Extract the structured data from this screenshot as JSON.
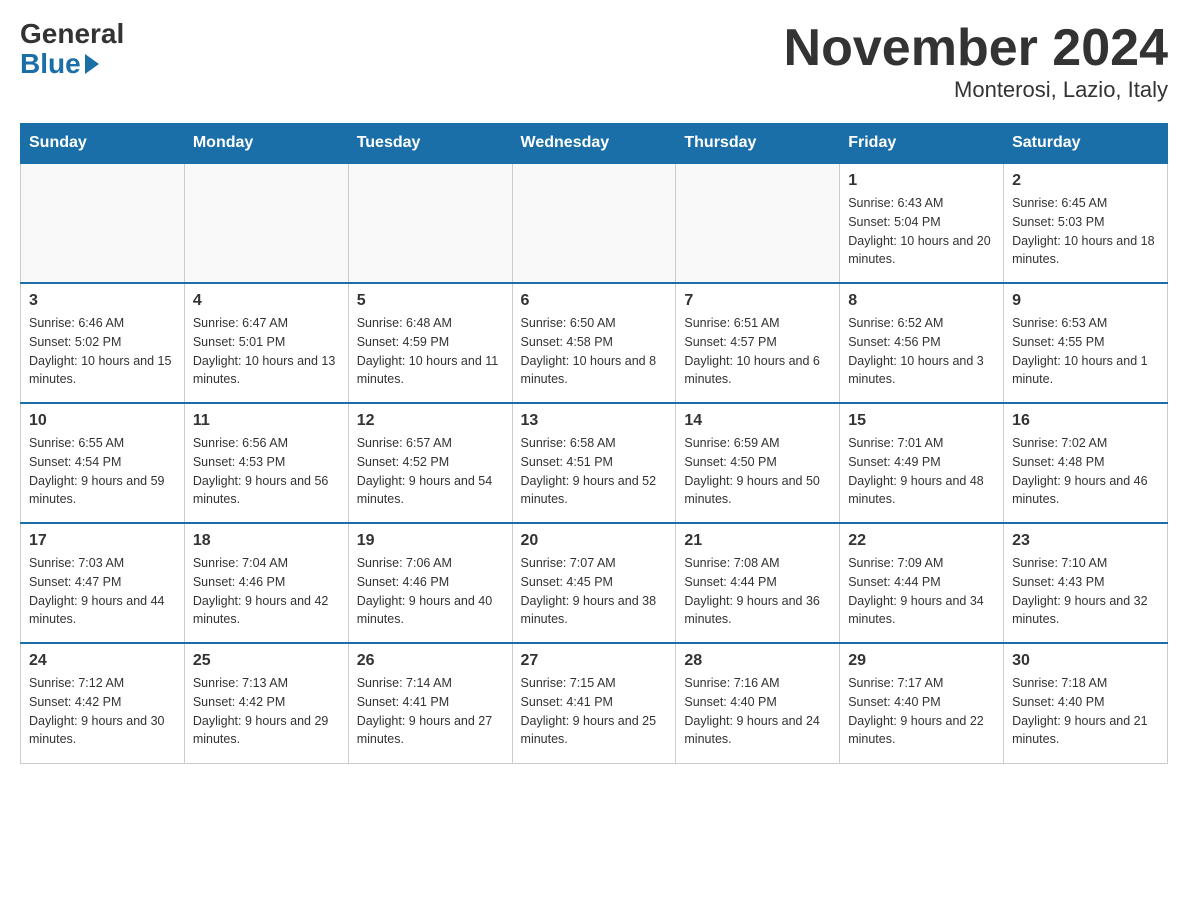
{
  "header": {
    "logo_general": "General",
    "logo_blue": "Blue",
    "title": "November 2024",
    "subtitle": "Monterosi, Lazio, Italy"
  },
  "days_of_week": [
    "Sunday",
    "Monday",
    "Tuesday",
    "Wednesday",
    "Thursday",
    "Friday",
    "Saturday"
  ],
  "weeks": [
    [
      {
        "day": "",
        "sunrise": "",
        "sunset": "",
        "daylight": ""
      },
      {
        "day": "",
        "sunrise": "",
        "sunset": "",
        "daylight": ""
      },
      {
        "day": "",
        "sunrise": "",
        "sunset": "",
        "daylight": ""
      },
      {
        "day": "",
        "sunrise": "",
        "sunset": "",
        "daylight": ""
      },
      {
        "day": "",
        "sunrise": "",
        "sunset": "",
        "daylight": ""
      },
      {
        "day": "1",
        "sunrise": "Sunrise: 6:43 AM",
        "sunset": "Sunset: 5:04 PM",
        "daylight": "Daylight: 10 hours and 20 minutes."
      },
      {
        "day": "2",
        "sunrise": "Sunrise: 6:45 AM",
        "sunset": "Sunset: 5:03 PM",
        "daylight": "Daylight: 10 hours and 18 minutes."
      }
    ],
    [
      {
        "day": "3",
        "sunrise": "Sunrise: 6:46 AM",
        "sunset": "Sunset: 5:02 PM",
        "daylight": "Daylight: 10 hours and 15 minutes."
      },
      {
        "day": "4",
        "sunrise": "Sunrise: 6:47 AM",
        "sunset": "Sunset: 5:01 PM",
        "daylight": "Daylight: 10 hours and 13 minutes."
      },
      {
        "day": "5",
        "sunrise": "Sunrise: 6:48 AM",
        "sunset": "Sunset: 4:59 PM",
        "daylight": "Daylight: 10 hours and 11 minutes."
      },
      {
        "day": "6",
        "sunrise": "Sunrise: 6:50 AM",
        "sunset": "Sunset: 4:58 PM",
        "daylight": "Daylight: 10 hours and 8 minutes."
      },
      {
        "day": "7",
        "sunrise": "Sunrise: 6:51 AM",
        "sunset": "Sunset: 4:57 PM",
        "daylight": "Daylight: 10 hours and 6 minutes."
      },
      {
        "day": "8",
        "sunrise": "Sunrise: 6:52 AM",
        "sunset": "Sunset: 4:56 PM",
        "daylight": "Daylight: 10 hours and 3 minutes."
      },
      {
        "day": "9",
        "sunrise": "Sunrise: 6:53 AM",
        "sunset": "Sunset: 4:55 PM",
        "daylight": "Daylight: 10 hours and 1 minute."
      }
    ],
    [
      {
        "day": "10",
        "sunrise": "Sunrise: 6:55 AM",
        "sunset": "Sunset: 4:54 PM",
        "daylight": "Daylight: 9 hours and 59 minutes."
      },
      {
        "day": "11",
        "sunrise": "Sunrise: 6:56 AM",
        "sunset": "Sunset: 4:53 PM",
        "daylight": "Daylight: 9 hours and 56 minutes."
      },
      {
        "day": "12",
        "sunrise": "Sunrise: 6:57 AM",
        "sunset": "Sunset: 4:52 PM",
        "daylight": "Daylight: 9 hours and 54 minutes."
      },
      {
        "day": "13",
        "sunrise": "Sunrise: 6:58 AM",
        "sunset": "Sunset: 4:51 PM",
        "daylight": "Daylight: 9 hours and 52 minutes."
      },
      {
        "day": "14",
        "sunrise": "Sunrise: 6:59 AM",
        "sunset": "Sunset: 4:50 PM",
        "daylight": "Daylight: 9 hours and 50 minutes."
      },
      {
        "day": "15",
        "sunrise": "Sunrise: 7:01 AM",
        "sunset": "Sunset: 4:49 PM",
        "daylight": "Daylight: 9 hours and 48 minutes."
      },
      {
        "day": "16",
        "sunrise": "Sunrise: 7:02 AM",
        "sunset": "Sunset: 4:48 PM",
        "daylight": "Daylight: 9 hours and 46 minutes."
      }
    ],
    [
      {
        "day": "17",
        "sunrise": "Sunrise: 7:03 AM",
        "sunset": "Sunset: 4:47 PM",
        "daylight": "Daylight: 9 hours and 44 minutes."
      },
      {
        "day": "18",
        "sunrise": "Sunrise: 7:04 AM",
        "sunset": "Sunset: 4:46 PM",
        "daylight": "Daylight: 9 hours and 42 minutes."
      },
      {
        "day": "19",
        "sunrise": "Sunrise: 7:06 AM",
        "sunset": "Sunset: 4:46 PM",
        "daylight": "Daylight: 9 hours and 40 minutes."
      },
      {
        "day": "20",
        "sunrise": "Sunrise: 7:07 AM",
        "sunset": "Sunset: 4:45 PM",
        "daylight": "Daylight: 9 hours and 38 minutes."
      },
      {
        "day": "21",
        "sunrise": "Sunrise: 7:08 AM",
        "sunset": "Sunset: 4:44 PM",
        "daylight": "Daylight: 9 hours and 36 minutes."
      },
      {
        "day": "22",
        "sunrise": "Sunrise: 7:09 AM",
        "sunset": "Sunset: 4:44 PM",
        "daylight": "Daylight: 9 hours and 34 minutes."
      },
      {
        "day": "23",
        "sunrise": "Sunrise: 7:10 AM",
        "sunset": "Sunset: 4:43 PM",
        "daylight": "Daylight: 9 hours and 32 minutes."
      }
    ],
    [
      {
        "day": "24",
        "sunrise": "Sunrise: 7:12 AM",
        "sunset": "Sunset: 4:42 PM",
        "daylight": "Daylight: 9 hours and 30 minutes."
      },
      {
        "day": "25",
        "sunrise": "Sunrise: 7:13 AM",
        "sunset": "Sunset: 4:42 PM",
        "daylight": "Daylight: 9 hours and 29 minutes."
      },
      {
        "day": "26",
        "sunrise": "Sunrise: 7:14 AM",
        "sunset": "Sunset: 4:41 PM",
        "daylight": "Daylight: 9 hours and 27 minutes."
      },
      {
        "day": "27",
        "sunrise": "Sunrise: 7:15 AM",
        "sunset": "Sunset: 4:41 PM",
        "daylight": "Daylight: 9 hours and 25 minutes."
      },
      {
        "day": "28",
        "sunrise": "Sunrise: 7:16 AM",
        "sunset": "Sunset: 4:40 PM",
        "daylight": "Daylight: 9 hours and 24 minutes."
      },
      {
        "day": "29",
        "sunrise": "Sunrise: 7:17 AM",
        "sunset": "Sunset: 4:40 PM",
        "daylight": "Daylight: 9 hours and 22 minutes."
      },
      {
        "day": "30",
        "sunrise": "Sunrise: 7:18 AM",
        "sunset": "Sunset: 4:40 PM",
        "daylight": "Daylight: 9 hours and 21 minutes."
      }
    ]
  ]
}
